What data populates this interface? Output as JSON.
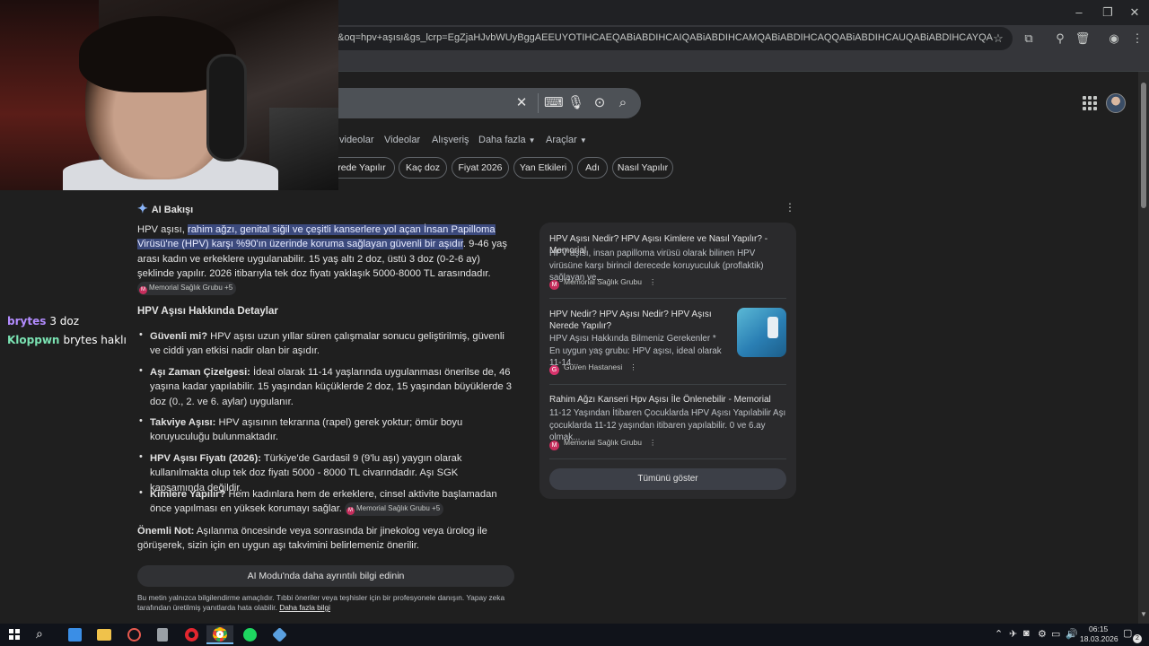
{
  "browser": {
    "url": "&oq=hpv+aşısı&gs_lcrp=EgZjaHJvbWUyBggAEEUYOTIHCAEQABiABDIHCAIQABiABDIHCAMQABiABDIHCAQQABiABDIHCAUQABiABDIHCAYQABiABDIHCAcQABiABDIHCAgQA..."
  },
  "search": {
    "tabs": [
      "videolar",
      "Videolar",
      "Alışveriş",
      "Daha fazla",
      "Araçlar"
    ],
    "chips": [
      "erede Yapılır",
      "Kaç doz",
      "Fiyat 2026",
      "Yan Etkileri",
      "Adı",
      "Nasıl Yapılır"
    ]
  },
  "chat": [
    {
      "user": "brytes",
      "message": "3 doz"
    },
    {
      "user": "Kloppwn",
      "message": "brytes haklı"
    }
  ],
  "ai_overview": {
    "title": "AI Bakışı",
    "intro_prefix": "HPV aşısı, ",
    "intro_highlight": "rahim ağzı, genital siğil ve çeşitli kanserlere yol açan İnsan Papilloma Virüsü'ne (HPV) karşı %90'ın üzerinde koruma sağlayan güvenli bir aşıdır",
    "intro_rest": ". 9-46 yaş arası kadın ve erkeklere uygulanabilir. 15 yaş altı 2 doz, üstü 3 doz (0-2-6 ay) şeklinde yapılır. 2026 itibarıyla tek doz fiyatı yaklaşık 5000-8000 TL arasındadır.",
    "citation": "Memorial Sağlık Grubu +5",
    "details_heading": "HPV Aşısı Hakkında Detaylar",
    "bullets": [
      {
        "label": "Güvenli mi?",
        "text": " HPV aşısı uzun yıllar süren çalışmalar sonucu geliştirilmiş, güvenli ve ciddi yan etkisi nadir olan bir aşıdır."
      },
      {
        "label": "Aşı Zaman Çizelgesi:",
        "text": " İdeal olarak 11-14 yaşlarında uygulanması önerilse de, 46 yaşına kadar yapılabilir. 15 yaşından küçüklerde 2 doz, 15 yaşından büyüklerde 3 doz (0., 2. ve 6. aylar) uygulanır."
      },
      {
        "label": "Takviye Aşısı:",
        "text": " HPV aşısının tekrarına (rapel) gerek yoktur; ömür boyu koruyuculuğu bulunmaktadır."
      },
      {
        "label": "HPV Aşısı Fiyatı (2026):",
        "text": " Türkiye'de Gardasil 9 (9'lu aşı) yaygın olarak kullanılmakta olup tek doz fiyatı 5000 - 8000 TL civarındadır. Aşı SGK kapsamında değildir."
      },
      {
        "label": "Kimlere Yapılır?",
        "text": " Hem kadınlara hem de erkeklere, cinsel aktivite başlamadan önce yapılması en yüksek korumayı sağlar."
      }
    ],
    "bullet_citation": "Memorial Sağlık Grubu +5",
    "note_label": "Önemli Not:",
    "note_text": " Aşılanma öncesinde veya sonrasında bir jinekolog veya ürolog ile görüşerek, sizin için en uygun aşı takvimini belirlemeniz önerilir.",
    "ai_mode_button": "AI Modu'nda daha ayrıntılı bilgi edinin",
    "disclaimer": "Bu metin yalnızca bilgilendirme amaçlıdır. Tıbbi öneriler veya teşhisler için bir profesyonele danışın. Yapay zeka tarafından üretilmiş yanıtlarda hata olabilir.",
    "disclaimer_link": "Daha fazla bilgi"
  },
  "sources": [
    {
      "title": "HPV Aşısı Nedir? HPV Aşısı Kimlere ve Nasıl Yapılır? - Memorial",
      "desc": "HPV aşısı, insan papilloma virüsü olarak bilinen HPV virüsüne karşı birincil derecede koruyuculuk (proflaktik) sağlayan ve...",
      "site": "Memorial Sağlık Grubu"
    },
    {
      "title": "HPV Nedir? HPV Aşısı Nedir? HPV Aşısı Nerede Yapılır?",
      "desc": "HPV Aşısı Hakkında Bilmeniz Gerekenler * En uygun yaş grubu: HPV aşısı, ideal olarak 11-14...",
      "site": "Güven Hastanesi"
    },
    {
      "title": "Rahim Ağzı Kanseri Hpv Aşısı İle Önlenebilir - Memorial",
      "desc": "11-12 Yaşından İtibaren Çocuklarda HPV Aşısı Yapılabilir Aşı çocuklarda 11-12 yaşından itibaren yapılabilir. 0 ve 6.ay olmak...",
      "site": "Memorial Sağlık Grubu"
    }
  ],
  "show_all": "Tümünü göster",
  "taskbar": {
    "time": "06:15",
    "date": "18.03.2026",
    "notifications": "2"
  }
}
